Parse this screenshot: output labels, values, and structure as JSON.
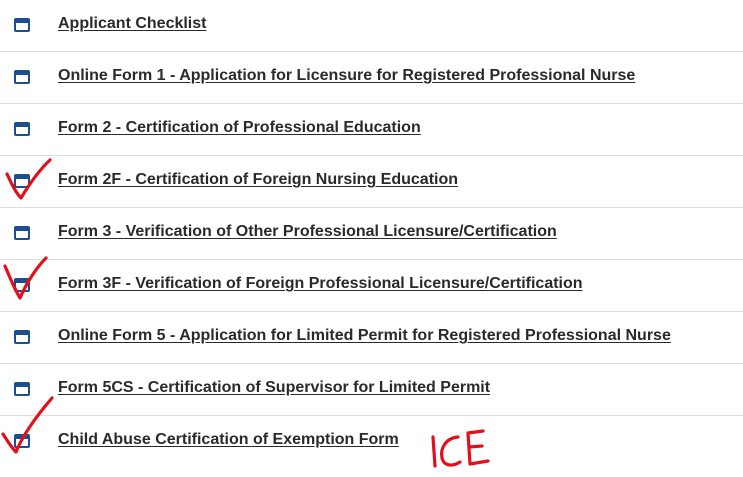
{
  "forms": [
    {
      "label": "Applicant Checklist",
      "icon": "window-icon"
    },
    {
      "label": "Online Form 1 - Application for Licensure for Registered Professional Nurse",
      "icon": "window-icon"
    },
    {
      "label": "Form 2 - Certification of Professional Education",
      "icon": "window-icon"
    },
    {
      "label": "Form 2F - Certification of Foreign Nursing Education",
      "icon": "window-icon"
    },
    {
      "label": "Form 3 - Verification of Other Professional Licensure/Certification",
      "icon": "window-icon"
    },
    {
      "label": "Form 3F - Verification of Foreign Professional Licensure/Certification",
      "icon": "window-icon"
    },
    {
      "label": "Online Form 5 - Application for Limited Permit for Registered Professional Nurse",
      "icon": "window-icon"
    },
    {
      "label": "Form 5CS - Certification of Supervisor for Limited Permit",
      "icon": "window-icon"
    },
    {
      "label": "Child Abuse Certification of Exemption Form",
      "icon": "window-icon"
    }
  ],
  "annotations": {
    "handwritten_note": "ICE",
    "checkmark_color": "#e3101c"
  },
  "colors": {
    "icon": "#1d4e8f",
    "link_text": "#2a2a2a",
    "divider": "#dddddd",
    "annotation": "#e3101c"
  }
}
